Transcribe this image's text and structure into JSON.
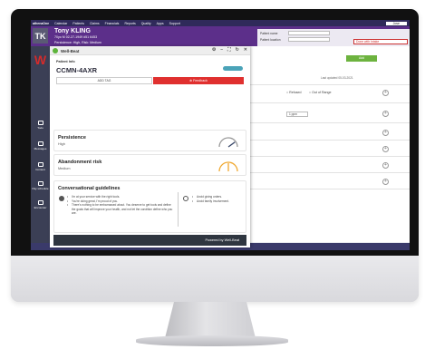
{
  "topnav": {
    "brand": "athenaOne",
    "items": [
      "Calendar",
      "Patients",
      "Claims",
      "Financials",
      "Reports",
      "Quality",
      "Apps",
      "Support"
    ],
    "search_value": "Jose"
  },
  "patient": {
    "initials": "TK",
    "name": "Tony KLING",
    "info": "70yo M  02-27-1949  #51  6453",
    "risk_line": "Persistence: High, Risk: Medium",
    "encounter_label": "Patient name",
    "location_label": "Patient location",
    "done_label": "Done with Intake"
  },
  "well_beat": {
    "title": "Well-Beat",
    "controls": [
      "⚙",
      "–",
      "⛶",
      "↻",
      "✕"
    ],
    "patient_info_label": "Patient Info",
    "patient_id": "CCMN-4AXR",
    "add_tag_label": "ADD TAG",
    "feedback_label": "Feedback",
    "persistence": {
      "title": "Persistence",
      "value": "High",
      "level": 0.8,
      "color": "#3b4a6b"
    },
    "abandonment": {
      "title": "Abandonment risk",
      "value": "Medium",
      "level": 0.5,
      "color": "#f0a830"
    },
    "conversational": {
      "title": "Conversational guidelines",
      "do": [
        "I'm at your service with the right tools.",
        "You're doing great, I'm proud of you.",
        "There's nothing to be embarrassed about. You deserve to get tools and define the goals that will improve your health, and not let the condition define who you are."
      ],
      "dont": [
        "Avoid giving orders.",
        "Avoid family involvement."
      ]
    },
    "footer": "Powered by Well-Beat"
  },
  "rail": [
    "Todo",
    "Messages",
    "Content",
    "Pay schedule",
    "Encounter"
  ],
  "bg": {
    "button": "Add",
    "note": "Last updated 05-03-2021",
    "radio_a": "Refused",
    "radio_b": "Out of Range",
    "select": "1 ppm"
  }
}
